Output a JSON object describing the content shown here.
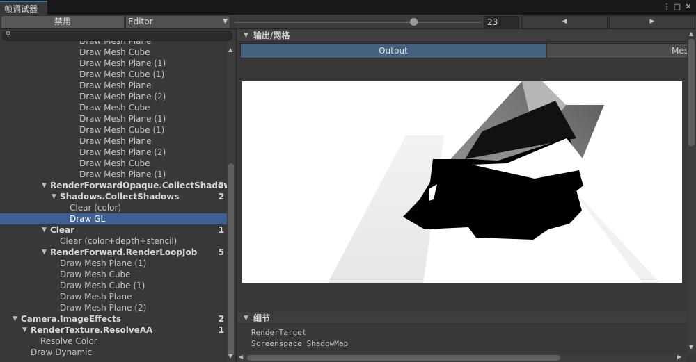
{
  "window": {
    "tab_title": "帧调试器",
    "menu_icon": "⋮",
    "maximize_icon": "□",
    "close_icon": "✕"
  },
  "toolbar": {
    "disable_label": "禁用",
    "target_select": "Editor",
    "frame_value": "23",
    "prev_icon": "◀",
    "next_icon": "▶"
  },
  "search": {
    "placeholder": ""
  },
  "tree": [
    {
      "label": "Draw Mesh Plane",
      "indent": 114,
      "count": ""
    },
    {
      "label": "Draw Mesh Cube",
      "indent": 114,
      "count": ""
    },
    {
      "label": "Draw Mesh Plane (1)",
      "indent": 114,
      "count": ""
    },
    {
      "label": "Draw Mesh Cube (1)",
      "indent": 114,
      "count": ""
    },
    {
      "label": "Draw Mesh Plane",
      "indent": 114,
      "count": ""
    },
    {
      "label": "Draw Mesh Plane (2)",
      "indent": 114,
      "count": ""
    },
    {
      "label": "Draw Mesh Cube",
      "indent": 114,
      "count": ""
    },
    {
      "label": "Draw Mesh Plane (1)",
      "indent": 114,
      "count": ""
    },
    {
      "label": "Draw Mesh Cube (1)",
      "indent": 114,
      "count": ""
    },
    {
      "label": "Draw Mesh Plane",
      "indent": 114,
      "count": ""
    },
    {
      "label": "Draw Mesh Plane (2)",
      "indent": 114,
      "count": ""
    },
    {
      "label": "Draw Mesh Cube",
      "indent": 114,
      "count": ""
    },
    {
      "label": "Draw Mesh Plane (1)",
      "indent": 114,
      "count": ""
    },
    {
      "label": "RenderForwardOpaque.CollectShadows",
      "indent": 72,
      "count": "2",
      "bold": true,
      "expanded": true
    },
    {
      "label": "Shadows.CollectShadows",
      "indent": 86,
      "count": "2",
      "bold": true,
      "expanded": true
    },
    {
      "label": "Clear (color)",
      "indent": 100,
      "count": ""
    },
    {
      "label": "Draw GL",
      "indent": 100,
      "count": "",
      "selected": true
    },
    {
      "label": "Clear",
      "indent": 72,
      "count": "1",
      "bold": true,
      "expanded": true
    },
    {
      "label": "Clear (color+depth+stencil)",
      "indent": 86,
      "count": ""
    },
    {
      "label": "RenderForward.RenderLoopJob",
      "indent": 72,
      "count": "5",
      "bold": true,
      "expanded": true
    },
    {
      "label": "Draw Mesh Plane (1)",
      "indent": 86,
      "count": ""
    },
    {
      "label": "Draw Mesh Cube",
      "indent": 86,
      "count": ""
    },
    {
      "label": "Draw Mesh Cube (1)",
      "indent": 86,
      "count": ""
    },
    {
      "label": "Draw Mesh Plane",
      "indent": 86,
      "count": ""
    },
    {
      "label": "Draw Mesh Plane (2)",
      "indent": 86,
      "count": ""
    },
    {
      "label": "Camera.ImageEffects",
      "indent": 30,
      "count": "2",
      "bold": true,
      "expanded": true
    },
    {
      "label": "RenderTexture.ResolveAA",
      "indent": 44,
      "count": "1",
      "bold": true,
      "expanded": true
    },
    {
      "label": "Resolve Color",
      "indent": 58,
      "count": ""
    },
    {
      "label": "Draw Dynamic",
      "indent": 44,
      "count": ""
    }
  ],
  "output_section": {
    "title": "输出/网格",
    "tab_output": "Output",
    "tab_mesh": "Mesh"
  },
  "details_section": {
    "title": "细节",
    "lines": [
      "RenderTarget",
      "Screenspace ShadowMap"
    ]
  }
}
